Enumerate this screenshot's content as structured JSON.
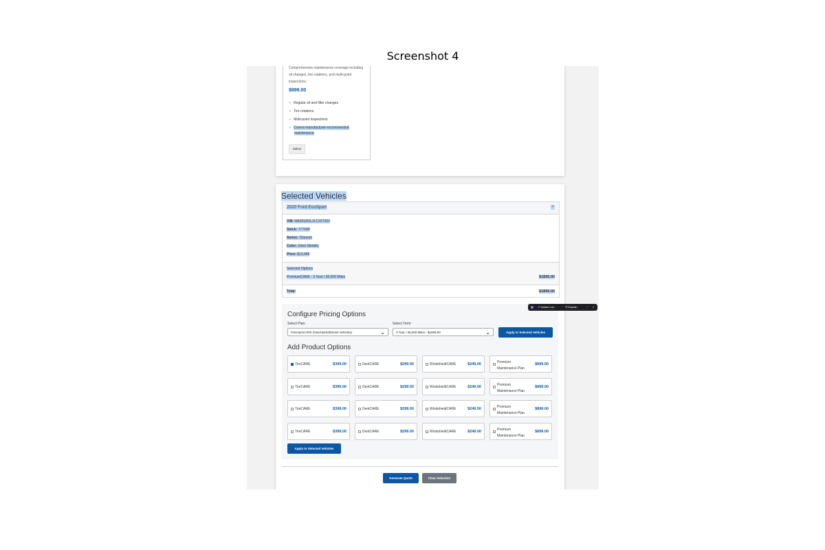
{
  "figure_title": "Screenshot 4",
  "plan_card": {
    "description": "Comprehensive maintenance coverage including oil changes, tire rotations, and multi-point inspections.",
    "price": "$899.00",
    "features": [
      "Regular oil and filter changes",
      "Tire rotations",
      "Multi-point inspections",
      "Covers manufacturer-recommended maintenance"
    ],
    "check_glyph": "✓",
    "select_label": "Select"
  },
  "selected_vehicles": {
    "title": "Selected Vehicles",
    "vehicle": {
      "name": "2020 Ford EcoSport",
      "close_glyph": "×",
      "vin_label": "VIN:",
      "vin": "MAJ6S3GL2LC327263",
      "stock_label": "Stock:",
      "stock": "T7769P",
      "series_label": "Series:",
      "series": "Titanium",
      "color_label": "Color:",
      "color": "Silver Metallic",
      "price_label": "Price:",
      "price": "$13,488",
      "options_label": "Selected Options",
      "option_name": "PremiumCARE - 3 Year / 36,000 Miles",
      "option_price": "$1895.00",
      "total_label": "Total:",
      "total": "$1895.00"
    }
  },
  "configure": {
    "title": "Configure Pricing Options",
    "plan_label": "Select Plan:",
    "plan_value": "PremiumCARE (Gas/Hybrid/Diesel Vehicles)",
    "term_label": "Select Term:",
    "term_value": "3 Year / 36,000 Miles - $1895.00",
    "chevron": "⌄",
    "apply_label": "Apply to Selected Vehicles"
  },
  "add_products": {
    "title": "Add Product Options",
    "products": [
      {
        "name": "TireCARE",
        "price": "$399.00",
        "checked": true
      },
      {
        "name": "DentCARE",
        "price": "$299.00"
      },
      {
        "name": "WindshieldCARE",
        "price": "$249.00"
      },
      {
        "name": "Premium Maintenance Plan",
        "price": "$899.00"
      },
      {
        "name": "TireCARE",
        "price": "$399.00"
      },
      {
        "name": "DentCARE",
        "price": "$299.00"
      },
      {
        "name": "WindshieldCARE",
        "price": "$249.00"
      },
      {
        "name": "Premium Maintenance Plan",
        "price": "$899.00"
      },
      {
        "name": "TireCARE",
        "price": "$399.00"
      },
      {
        "name": "DentCARE",
        "price": "$299.00"
      },
      {
        "name": "WindshieldCARE",
        "price": "$249.00"
      },
      {
        "name": "Premium Maintenance Plan",
        "price": "$899.00"
      },
      {
        "name": "TireCARE",
        "price": "$399.00"
      },
      {
        "name": "DentCARE",
        "price": "$299.00"
      },
      {
        "name": "WindshieldCARE",
        "price": "$249.00"
      },
      {
        "name": "Premium Maintenance Plan",
        "price": "$899.00"
      }
    ],
    "apply_label": "Apply to Selected Vehicles"
  },
  "actions": {
    "generate_label": "Generate Quote",
    "clear_label": "Clear Selection"
  },
  "floating_toolbar": {
    "instant_label": "↗ Instant Loo...",
    "explain_label": "⟲ Explain",
    "more_glyph": "⋮",
    "close_glyph": "×"
  },
  "colors": {
    "accent": "#0b57a6",
    "secondary": "#6c757d",
    "highlight": "#b8d6f7"
  }
}
